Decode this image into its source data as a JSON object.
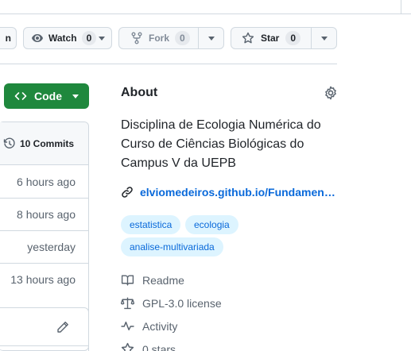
{
  "header": {
    "partial_button_label": "n",
    "watch": {
      "label": "Watch",
      "count": "0"
    },
    "fork": {
      "label": "Fork",
      "count": "0"
    },
    "star": {
      "label": "Star",
      "count": "0"
    }
  },
  "code_button": {
    "label": "Code"
  },
  "commits": {
    "label": "10 Commits",
    "rows": [
      "6 hours ago",
      "8 hours ago",
      "yesterday",
      "13 hours ago"
    ]
  },
  "about": {
    "title": "About",
    "description": "Disciplina de Ecologia Numérica do Curso de Ciências Biológicas do Campus V da UEPB",
    "link": "elviomedeiros.github.io/Fundamento…",
    "topics": [
      "estatistica",
      "ecologia",
      "analise-multivariada"
    ],
    "meta": [
      {
        "icon": "book-icon",
        "label": "Readme"
      },
      {
        "icon": "law-icon",
        "label": "GPL-3.0 license"
      },
      {
        "icon": "pulse-icon",
        "label": "Activity"
      },
      {
        "icon": "star-icon",
        "label": "0 stars"
      }
    ]
  },
  "colors": {
    "accent_link": "#0969da",
    "code_button": "#1f883d",
    "topic_bg": "#ddf4ff",
    "border": "#d1d9e0"
  }
}
